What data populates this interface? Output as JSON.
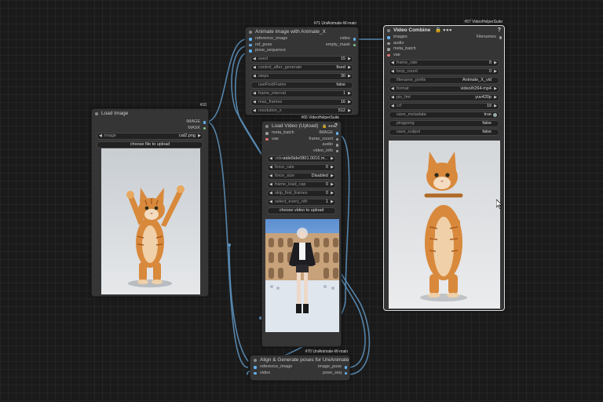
{
  "colors": {
    "wire": "#5b8fb9",
    "image_dot": "#64b5f6",
    "pose_dot": "#e0e0e0",
    "mask_dot": "#81c784",
    "audio_dot": "#9e9e9e"
  },
  "animate_node": {
    "id": "#71 UniAnimate-W-main",
    "title": "Animate image with Animate_X",
    "inputs": [
      "reference_image",
      "ref_pose",
      "pose_sequence"
    ],
    "outputs": [
      "video",
      "empty_mask"
    ],
    "widgets": [
      {
        "label": "seed",
        "value": "15",
        "arrows": true
      },
      {
        "label": "control_after_generate",
        "value": "fixed",
        "arrows": true
      },
      {
        "label": "steps",
        "value": "30",
        "arrows": true
      },
      {
        "label": "useFirstFrame",
        "value": "false",
        "arrows": false
      },
      {
        "label": "frame_interval",
        "value": "1",
        "arrows": true
      },
      {
        "label": "max_frames",
        "value": "16",
        "arrows": true
      },
      {
        "label": "resolution_x",
        "value": "512",
        "arrows": true
      }
    ]
  },
  "video_combine": {
    "id": "#57 VideoHelperSuite",
    "title": "Video Combine",
    "icons": "🔒 ●●●",
    "help": "?",
    "inputs": [
      "images",
      "audio",
      "meta_batch",
      "vae"
    ],
    "outputs": [
      "Filenames"
    ],
    "widgets": [
      {
        "label": "frame_rate",
        "value": "8",
        "arrows": true
      },
      {
        "label": "loop_count",
        "value": "0",
        "arrows": true
      },
      {
        "label": "filename_prefix",
        "value": "Animate_X_vid",
        "arrows": false
      },
      {
        "label": "format",
        "value": "video/h264-mp4",
        "arrows": true
      },
      {
        "label": "pix_fmt",
        "value": "yuv420p",
        "arrows": true
      },
      {
        "label": "crf",
        "value": "19",
        "arrows": true
      },
      {
        "label": "save_metadata",
        "value": "true",
        "arrows": false,
        "toggle": true
      },
      {
        "label": "pingpong",
        "value": "false",
        "arrows": false
      },
      {
        "label": "save_output",
        "value": "false",
        "arrows": false
      }
    ]
  },
  "load_image": {
    "id": "#10",
    "title": "Load Image",
    "outputs": [
      "IMAGE",
      "MASK"
    ],
    "image_widget": {
      "label": "image",
      "value": "cat2.png"
    },
    "upload_button": "choose file to upload"
  },
  "load_video": {
    "id": "#65 VideoHelperSuite",
    "title": "Load Video (Upload)",
    "icons": "🔒 ●●●",
    "help": "?",
    "inputs": [
      "meta_batch",
      "vae"
    ],
    "outputs": [
      "IMAGE",
      "frame_count",
      "audio",
      "video_info"
    ],
    "widgets": [
      {
        "label": "video",
        "value": "side5ide0801.0016.m...",
        "arrows": true
      },
      {
        "label": "force_rate",
        "value": "0",
        "arrows": true
      },
      {
        "label": "force_size",
        "value": "Disabled",
        "arrows": true
      },
      {
        "label": "frame_load_cap",
        "value": "0",
        "arrows": true
      },
      {
        "label": "skip_first_frames",
        "value": "0",
        "arrows": true
      },
      {
        "label": "select_every_nth",
        "value": "1",
        "arrows": true
      }
    ],
    "upload_button": "choose video to upload"
  },
  "align_node": {
    "id": "#70 UniAnimate-W-main",
    "title": "Align & Generate poses for UniAnimate",
    "inputs": [
      "reference_image",
      "video"
    ],
    "outputs": [
      "image_pose",
      "pose_seq"
    ]
  }
}
